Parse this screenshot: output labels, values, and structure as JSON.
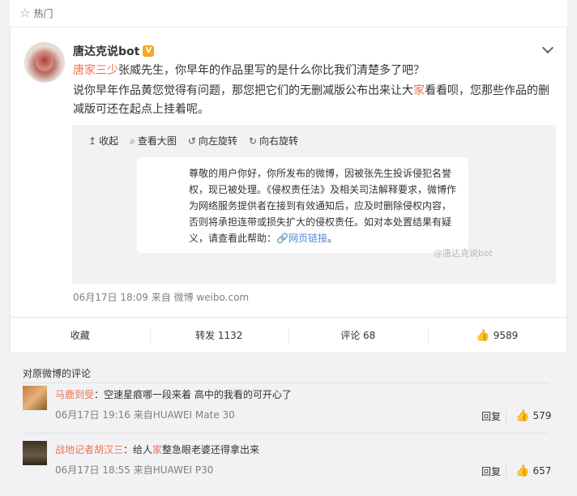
{
  "hot_bar": {
    "icon": "star-icon",
    "label": "热门"
  },
  "post": {
    "username": "唐达克说bot",
    "verified_badge": "V",
    "line1_mention": "唐家三少",
    "line1_rest": "张威先生，你早年的作品里写的是什么你比我们清楚多了吧？",
    "line2_part1": "说你早年作品黄您觉得有问题，那您把它们的无删减版公布出来让大",
    "line2_hl": "家",
    "line2_part2": "看看呗，您那些作品的删",
    "line3": "减版可还在起点上挂着呢。",
    "tools": {
      "collapse": "收起",
      "view_large": "查看大图",
      "rotate_left": "向左旋转",
      "rotate_right": "向右旋转"
    },
    "notice": {
      "text": "尊敬的用户你好，你所发布的微博，因被张先生投诉侵犯名誉权，现已被处理。《侵权责任法》及相关司法解释要求，微博作为网络服务提供者在接到有效通知后，应及时删除侵权内容，否则将承担连带或损失扩大的侵权责任。如对本处置结果有疑义，请查看此帮助：",
      "link": "网页链接",
      "link_suffix": "。"
    },
    "watermark": "@唐达克说bot",
    "timestamp": "06月17日 18:09  来自 微博 weibo.com"
  },
  "actions": {
    "favorite": "收藏",
    "repost": "转发 1132",
    "comment": "评论 68",
    "like_count": "9589"
  },
  "comments": {
    "title": "对原微博的评论",
    "items": [
      {
        "name": "马鹿到受",
        "text": "：空速星痕哪一段来着 高中的我看的可开心了",
        "meta": "06月17日 19:16 来自HUAWEI Mate 30",
        "reply": "回复",
        "likes": "579"
      },
      {
        "name": "战地记者胡汉三",
        "text_part1": "：给人",
        "text_hl": "家",
        "text_part2": "整急眼老婆还得拿出来",
        "meta": "06月17日 18:55 来自HUAWEI P30",
        "reply": "回复",
        "likes": "657"
      }
    ]
  },
  "colors": {
    "accent": "#eb7350",
    "link": "#4e8cd5",
    "background": "#f2f2f5"
  }
}
